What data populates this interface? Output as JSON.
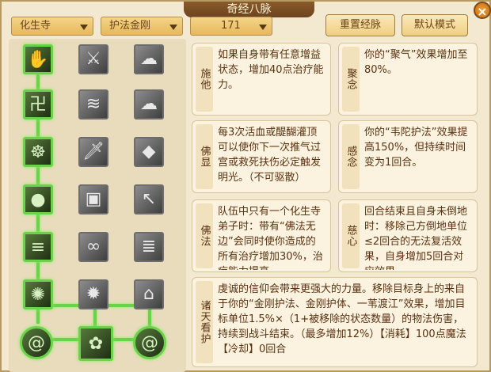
{
  "window": {
    "title": "奇经八脉",
    "close_icon": "close-icon"
  },
  "toolbar": {
    "sect": "化生寺",
    "school": "护法金刚",
    "level": "171",
    "reset_label": "重置经脉",
    "default_label": "默认模式"
  },
  "tree": {
    "rows": [
      {
        "icons": [
          "lotus-hand-icon",
          "split-blade-icon",
          "cloud-swirl-icon"
        ],
        "active": [
          true,
          false,
          false
        ]
      },
      {
        "icons": [
          "wheel-icon",
          "wave-icon",
          "cloud-pattern-icon"
        ],
        "active": [
          true,
          false,
          false
        ]
      },
      {
        "icons": [
          "buddha-icon",
          "dagger-icon",
          "rock-icon"
        ],
        "active": [
          true,
          false,
          false
        ]
      },
      {
        "icons": [
          "orb-icon",
          "book-icon",
          "arrow-icon"
        ],
        "active": [
          true,
          false,
          false
        ]
      },
      {
        "icons": [
          "lines-icon",
          "cloud-knot-icon",
          "scroll-icon"
        ],
        "active": [
          true,
          false,
          false
        ]
      },
      {
        "icons": [
          "radiance-icon",
          "sun-flower-icon",
          "pagoda-icon"
        ],
        "active": [
          true,
          false,
          false
        ]
      },
      {
        "icons": [
          "spiral-icon",
          "conch-icon",
          "spiral-right-icon"
        ],
        "active": [
          true,
          true,
          true
        ]
      }
    ]
  },
  "skills": [
    {
      "name": "施他",
      "desc": "如果自身带有任意增益状态，增加40点治疗能力。"
    },
    {
      "name": "聚念",
      "desc": "你的“聚气”效果增加至80%。"
    },
    {
      "name": "佛显",
      "desc": "每3次活血或醍醐灌顶可以使你下一次推气过宫或救死扶伤必定触发明光。（不可驱散）"
    },
    {
      "name": "感念",
      "desc": "你的“韦陀护法”效果提高150%，但持续时间变为1回合。"
    },
    {
      "name": "佛法",
      "desc": "队伍中只有一个化生寺弟子时：带有“佛法无边”会同时使你造成的所有治疗增加30%，治疗能力提高"
    },
    {
      "name": "慈心",
      "desc": "回合结束且自身未倒地时：移除己方倒地单位≤2回合的无法复活效果，自身增加5回合对应效果"
    },
    {
      "name": "诸天看护",
      "desc": "虔诚的信仰会带来更强大的力量。移除目标身上的来自于你的“金刚护法、金刚护体、一苇渡江”效果，增加目标单位1.5%×（1+被移除的状态数量）的物法伤害，持续到战斗结束。（最多增加12%）【消耗】100点魔法【冷却】0回合"
    }
  ],
  "colors": {
    "active_green": "#6ad24b",
    "card_bg": "#fbf3df",
    "text": "#5a3212"
  }
}
